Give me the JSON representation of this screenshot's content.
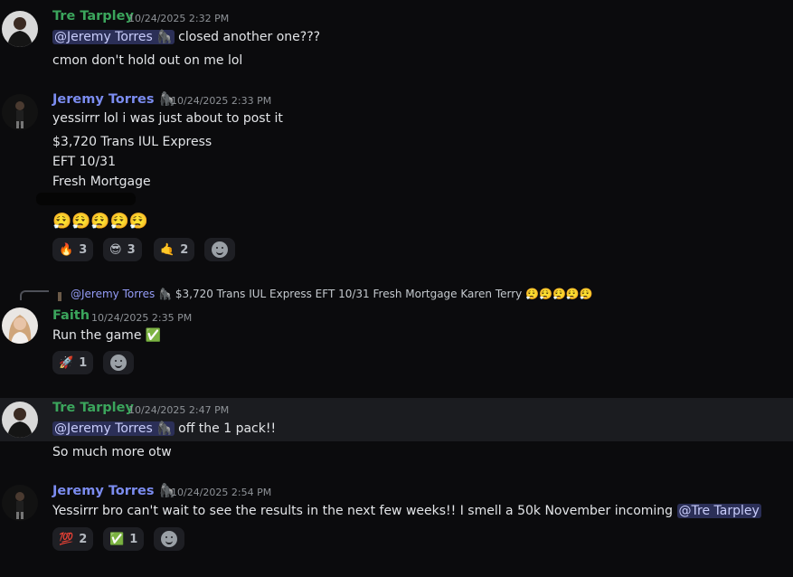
{
  "m1": {
    "author": "Tre Tarpley",
    "time": "10/24/2025 2:32 PM",
    "mention": "@Jeremy Torres",
    "text1": "closed another one???",
    "text2": "cmon don't hold out on me lol"
  },
  "m2": {
    "author": "Jeremy Torres",
    "time": "10/24/2025 2:33 PM",
    "line1": "yessirrr lol i was just about to post it",
    "line2": "$3,720 Trans IUL Express",
    "line3": "EFT 10/31",
    "line4": "Fresh Mortgage",
    "emojis": "😮‍💨😮‍💨😮‍💨😮‍💨😮‍💨",
    "reactions": [
      {
        "emoji": "🔥",
        "count": "3"
      },
      {
        "emoji": "😎",
        "count": "3"
      },
      {
        "emoji": "🤙",
        "count": "2"
      }
    ]
  },
  "m3": {
    "reply_author": "@Jeremy Torres",
    "reply_text": "$3,720 Trans IUL Express EFT 10/31 Fresh Mortgage  Karen Terry 😮‍💨😮‍💨😮‍💨😮‍💨😮‍💨",
    "author": "Faith",
    "time": "10/24/2025 2:35 PM",
    "text": "Run the game ✅",
    "reactions": [
      {
        "emoji": "🚀",
        "count": "1"
      }
    ]
  },
  "m4": {
    "author": "Tre Tarpley",
    "time": "10/24/2025 2:47 PM",
    "mention": "@Jeremy Torres",
    "text1": "off the 1 pack!!",
    "text2": "So much more otw"
  },
  "m5": {
    "author": "Jeremy Torres",
    "time": "10/24/2025 2:54 PM",
    "text": "Yessirrr bro can't wait to see the results in the next few weeks!! I smell a 50k November incoming",
    "mention": "@Tre Tarpley",
    "reactions": [
      {
        "emoji": "💯",
        "count": "2"
      },
      {
        "emoji": "✅",
        "count": "1"
      }
    ]
  },
  "colors": {
    "tre": "#3ba55c",
    "jeremy": "#7b8cf0",
    "faith": "#3ba55c"
  },
  "icons": [
    "gorilla-badge-icon",
    "add-reaction-icon"
  ]
}
